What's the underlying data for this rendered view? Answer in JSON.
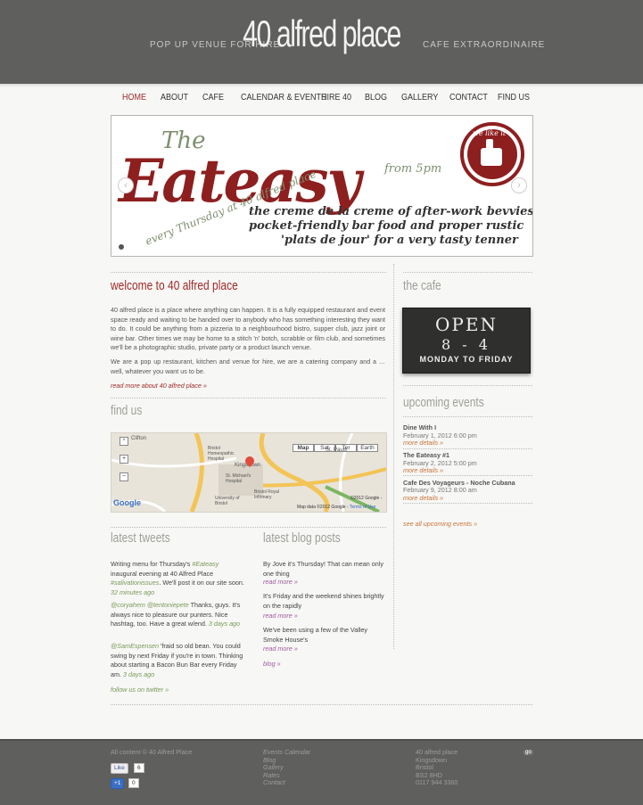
{
  "header": {
    "title": "40 alfred place",
    "tag_left": "POP UP VENUE FOR HIRE",
    "tag_right": "CAFE EXTRAORDINAIRE"
  },
  "nav": {
    "items": [
      "HOME",
      "ABOUT",
      "CAFE",
      "CALENDAR & EVENTS",
      "HIRE 40",
      "BLOG",
      "GALLERY",
      "CONTACT",
      "FIND US"
    ],
    "active": "HOME"
  },
  "banner": {
    "line1": "The",
    "line2": "Eateasy",
    "line3": "every Thursday at 40 alfred place",
    "line4": "from 5pm",
    "line5": "the creme de la creme of after-work bevvies",
    "line6": "pocket-friendly bar food and proper rustic",
    "line7": "'plats de jour' for a very tasty tenner",
    "badge": "we like it",
    "prev": "‹",
    "next": "›"
  },
  "welcome": {
    "title": "welcome to 40 alfred place",
    "p1": "40 alfred place is a place where anything can happen. It is a fully equipped restaurant and event space ready and waiting to be handed over to anybody who has something interesting they want to do. It could be anything from a pizzeria to a neighbourhood bistro, supper club, jazz joint or wine bar. Other times we may be home to a stitch 'n' botch, scrabble or film club, and sometimes we'll be a photographic studio, private party or a product launch venue.",
    "p2": "We are a pop up restaurant, kitchen and venue for hire, we are a catering company and a … well, whatever you want us to be.",
    "more": "read more about 40 alfred place »"
  },
  "findus": {
    "title": "find us",
    "map_buttons": [
      "Map",
      "Sat",
      "Ter",
      "Earth"
    ],
    "labels": [
      "Clifton",
      "Bristol Homeopathic Hospital",
      "Kingsdown",
      "St. Pauls",
      "St. Michael's Hospital",
      "University of Bristol",
      "Bristol Royal Infirmary"
    ],
    "copyright": "©2012 Google -",
    "map_data": "Map data ©2012 Google -",
    "terms": "Terms of Use",
    "google": "Google"
  },
  "cafe": {
    "title": "the cafe",
    "open": "OPEN",
    "hours": "8 - 4",
    "days": "MONDAY TO FRIDAY"
  },
  "events": {
    "title": "upcoming events",
    "items": [
      {
        "name": "Dine With I",
        "date": "February 1, 2012 6:00 pm",
        "more": "more details »"
      },
      {
        "name": "The Eateasy #1",
        "date": "February 2, 2012 5:00 pm",
        "more": "more details »"
      },
      {
        "name": "Cafe Des Voyageurs - Noche Cubana",
        "date": "February 9, 2012 8:00 am",
        "more": "more details »"
      }
    ],
    "all": "see all upcoming events »"
  },
  "tweets": {
    "title": "latest tweets",
    "t1_a": "Writing menu for Thursday's ",
    "t1_tag": "#Eateasy",
    "t1_b": " inaugural evening at 40 Alfred Place ",
    "t1_tag2": "#salivationissues",
    "t1_c": ". We'll post it on our site soon. ",
    "t1_time": "32 minutes ago",
    "t2_user": "@coryahem",
    "t2_user2": "@tentoniepete",
    "t2_text": " Thanks, guys. It's always nice to pleasure our punters. Nice hashtag, too. Have a great w/end.",
    "t2_time": "3 days ago",
    "t3_user": "@SamEspensen",
    "t3_text": " 'fraid so old bean. You could swing by next Friday if you're in town. Thinking about starting a Bacon Bun Bar every Friday am.",
    "t3_time": "3 days ago",
    "follow": "follow us on twitter »"
  },
  "blog": {
    "title": "latest blog posts",
    "items": [
      {
        "text": "By Jove it's Thursday! That can mean only one thing",
        "more": "read more »"
      },
      {
        "text": "It's Friday and the weekend shines brightly on the rapidly",
        "more": "read more »"
      },
      {
        "text": "We've been using a few of the Valley Smoke House's",
        "more": "read more »"
      }
    ],
    "all": "blog »"
  },
  "footer": {
    "copyright": "All content © 40 Alfred Place",
    "like": "Like",
    "like_count": "6",
    "plus": "+1",
    "plus_count": "0",
    "links": [
      "Events Calendar",
      "Blog",
      "Gallery",
      "Rates",
      "Contact"
    ],
    "address": [
      "40 alfred place",
      "Kingsdown",
      "Bristol",
      "BS2 8HD",
      "0117 944 3360"
    ],
    "badge": "go"
  },
  "colors": {
    "header": "#5f5f5d",
    "accent": "#a02a2a",
    "link_orange": "#c8743a",
    "link_green": "#7a9a5a"
  }
}
